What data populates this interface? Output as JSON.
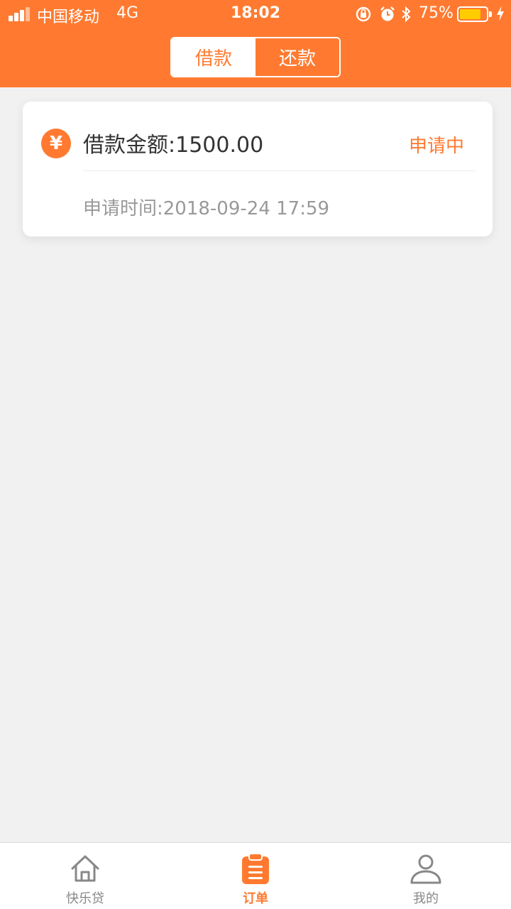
{
  "status_bar": {
    "carrier": "中国移动",
    "network": "4G",
    "time": "18:02",
    "battery_percent": "75%",
    "battery_level": 0.75,
    "battery_color": "#ffcc00"
  },
  "header": {
    "bg_color": "#ff7a30",
    "tabs": [
      {
        "label": "借款",
        "active": true
      },
      {
        "label": "还款",
        "active": false
      }
    ]
  },
  "orders": [
    {
      "icon": "yen-icon",
      "amount_text": "借款金额:1500.00",
      "status": "申请中",
      "apply_time": "申请时间:2018-09-24 17:59"
    }
  ],
  "tabbar": {
    "items": [
      {
        "label": "快乐贷",
        "icon": "home-icon",
        "active": false
      },
      {
        "label": "订单",
        "icon": "clipboard-icon",
        "active": true
      },
      {
        "label": "我的",
        "icon": "user-icon",
        "active": false
      }
    ]
  }
}
